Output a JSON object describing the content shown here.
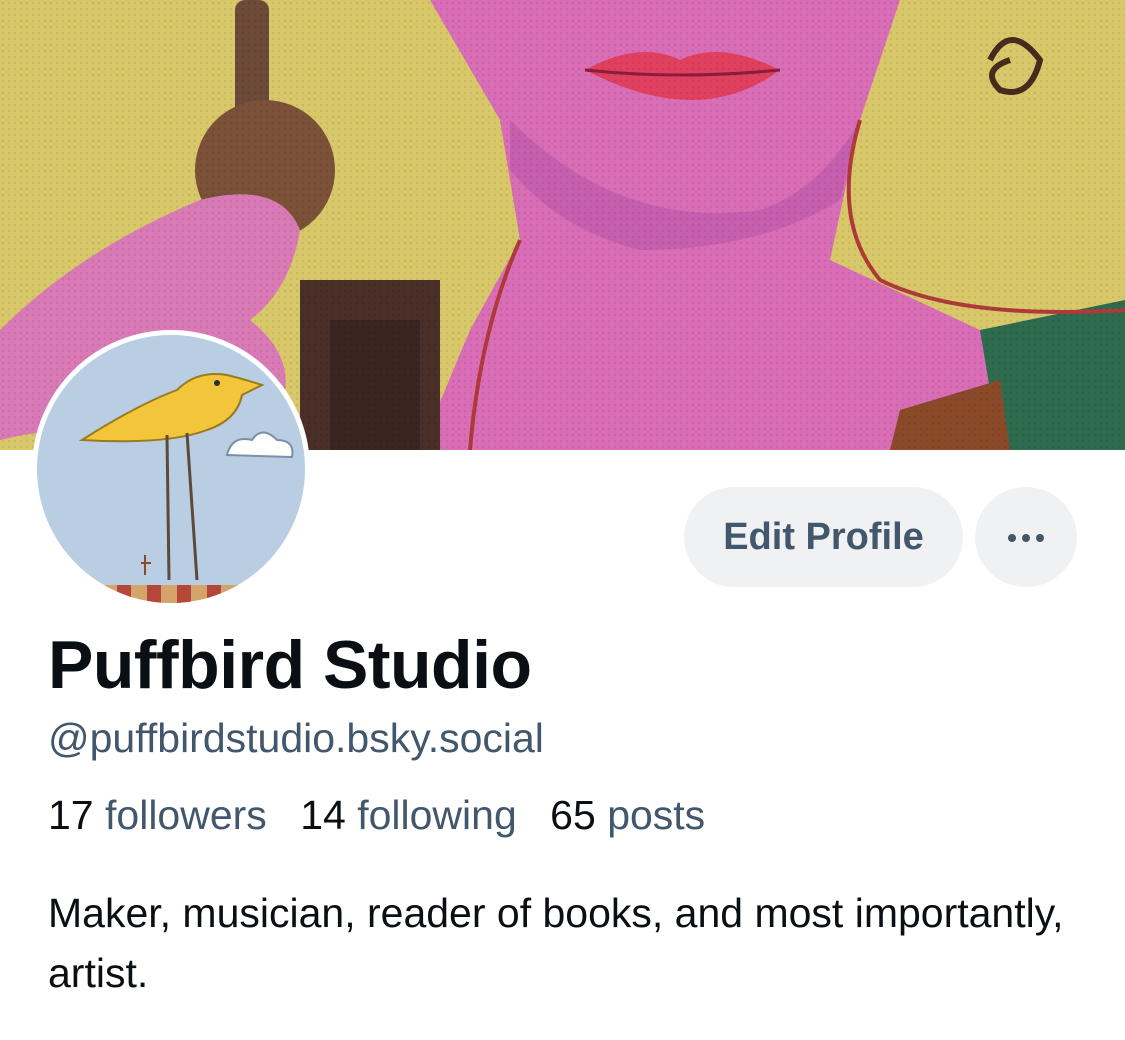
{
  "profile": {
    "display_name": "Puffbird Studio",
    "handle": "@puffbirdstudio.bsky.social",
    "bio": "Maker, musician, reader of books, and most importantly, artist.",
    "banner_icon": "painted-portrait-banner",
    "avatar_icon": "yellow-bird-avatar"
  },
  "stats": {
    "followers_count": "17",
    "followers_label": "followers",
    "following_count": "14",
    "following_label": "following",
    "posts_count": "65",
    "posts_label": "posts"
  },
  "actions": {
    "edit_profile_label": "Edit Profile",
    "more_icon": "ellipsis-icon"
  },
  "colors": {
    "text_primary": "#0b0f14",
    "text_secondary": "#42576c",
    "button_bg": "#eff1f3"
  }
}
